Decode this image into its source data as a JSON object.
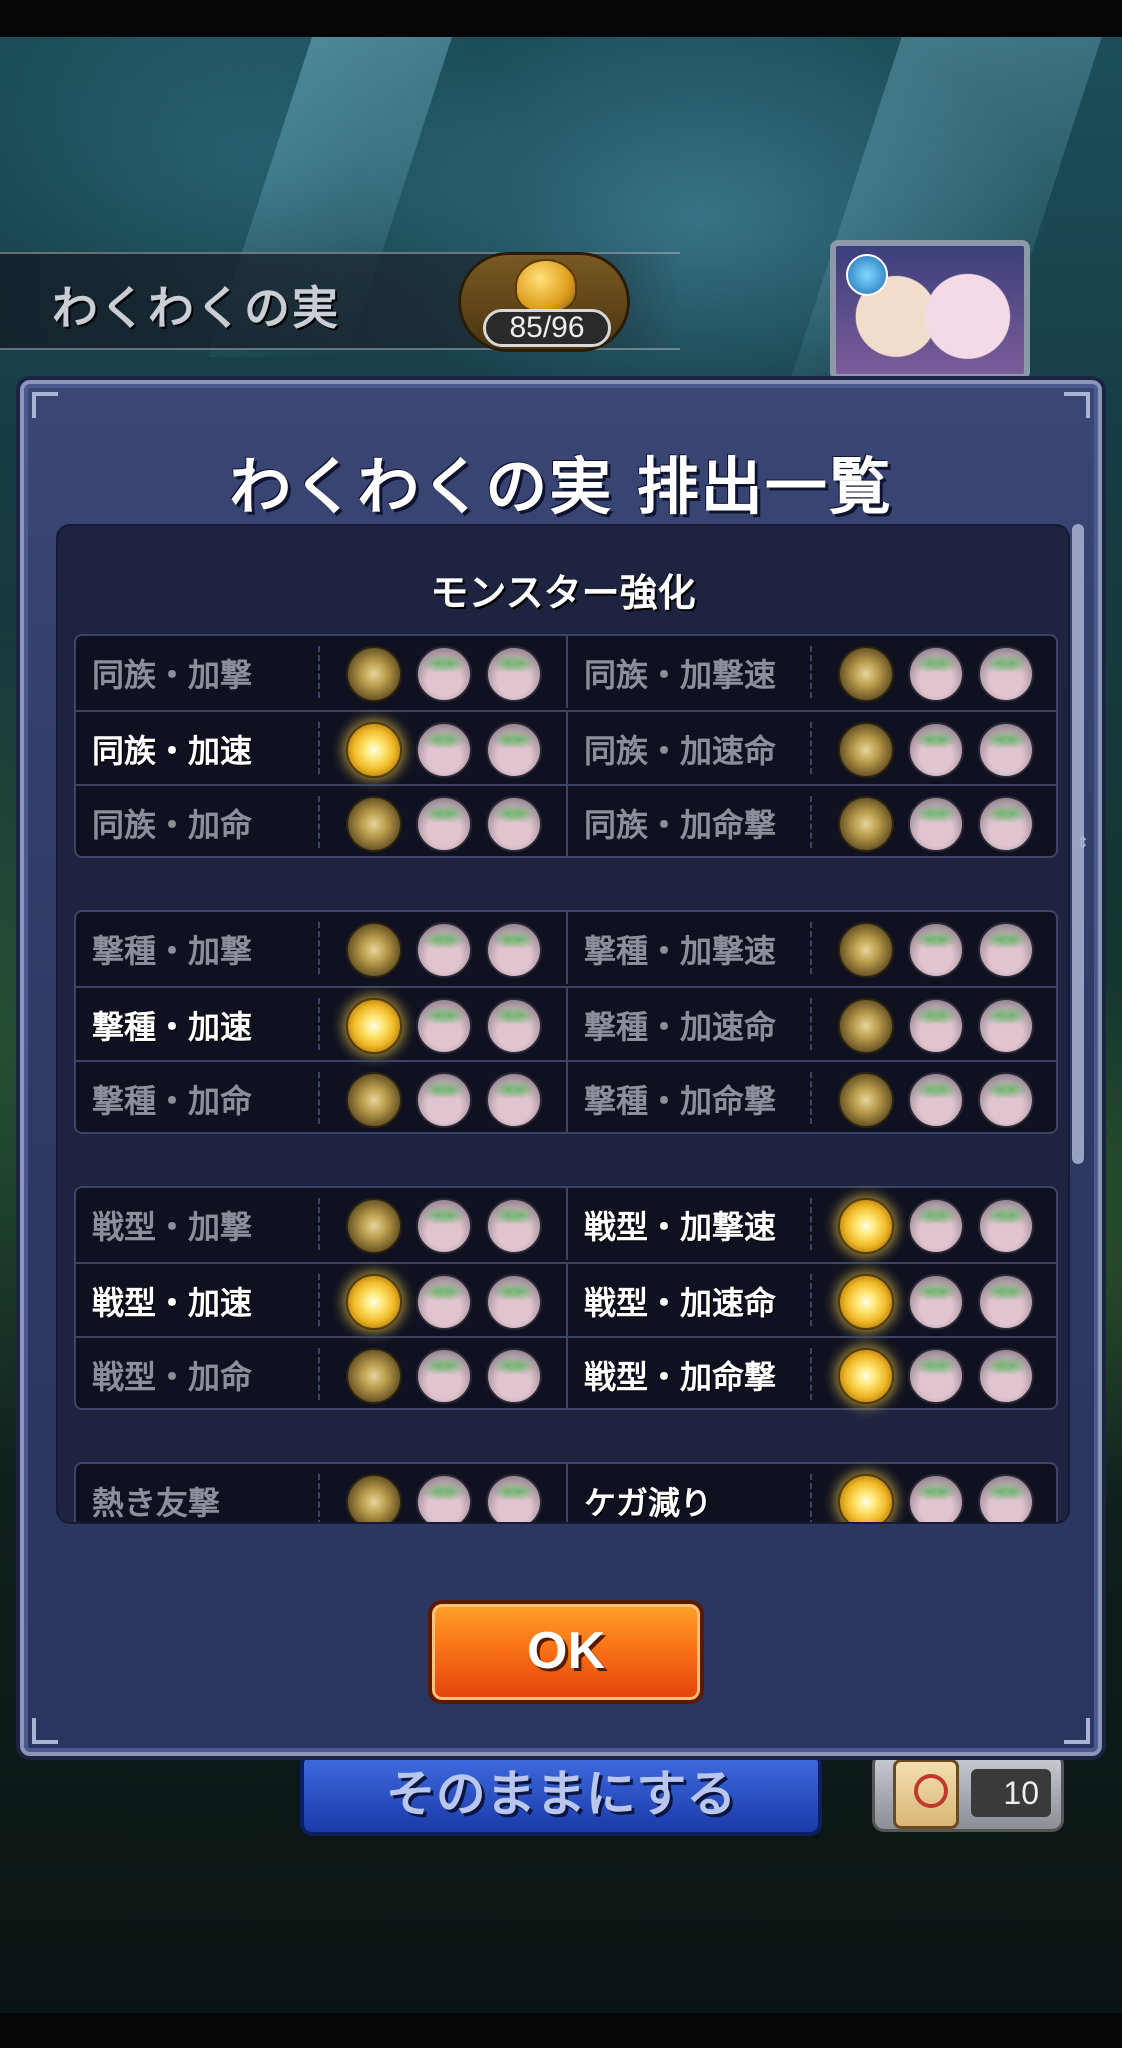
{
  "header": {
    "title": "わくわくの実",
    "fruit_count": "85/96"
  },
  "dialog": {
    "title": "わくわくの実 排出一覧",
    "section_title": "モンスター強化",
    "ok_label": "OK",
    "groups": [
      {
        "rows": [
          [
            {
              "label": "同族・加撃",
              "available": false
            },
            {
              "label": "同族・加撃速",
              "available": false
            }
          ],
          [
            {
              "label": "同族・加速",
              "available": true
            },
            {
              "label": "同族・加速命",
              "available": false
            }
          ],
          [
            {
              "label": "同族・加命",
              "available": false
            },
            {
              "label": "同族・加命撃",
              "available": false
            }
          ]
        ]
      },
      {
        "rows": [
          [
            {
              "label": "撃種・加撃",
              "available": false
            },
            {
              "label": "撃種・加撃速",
              "available": false
            }
          ],
          [
            {
              "label": "撃種・加速",
              "available": true
            },
            {
              "label": "撃種・加速命",
              "available": false
            }
          ],
          [
            {
              "label": "撃種・加命",
              "available": false
            },
            {
              "label": "撃種・加命撃",
              "available": false
            }
          ]
        ]
      },
      {
        "rows": [
          [
            {
              "label": "戦型・加撃",
              "available": false
            },
            {
              "label": "戦型・加撃速",
              "available": true
            }
          ],
          [
            {
              "label": "戦型・加速",
              "available": true
            },
            {
              "label": "戦型・加速命",
              "available": true
            }
          ],
          [
            {
              "label": "戦型・加命",
              "available": false
            },
            {
              "label": "戦型・加命撃",
              "available": true
            }
          ]
        ]
      },
      {
        "rows": [
          [
            {
              "label": "熱き友撃",
              "available": false
            },
            {
              "label": "ケガ減り",
              "available": true
            }
          ]
        ]
      }
    ],
    "scroll_position": 0.0
  },
  "bottom": {
    "leave_button_label": "そのままにする",
    "scroll_count": "10"
  },
  "icons": {
    "fruit": "golden-fruit-icon",
    "grade_high": "gold-seed-icon",
    "grade_mid": "bud-icon",
    "grade_low": "bud-icon"
  }
}
